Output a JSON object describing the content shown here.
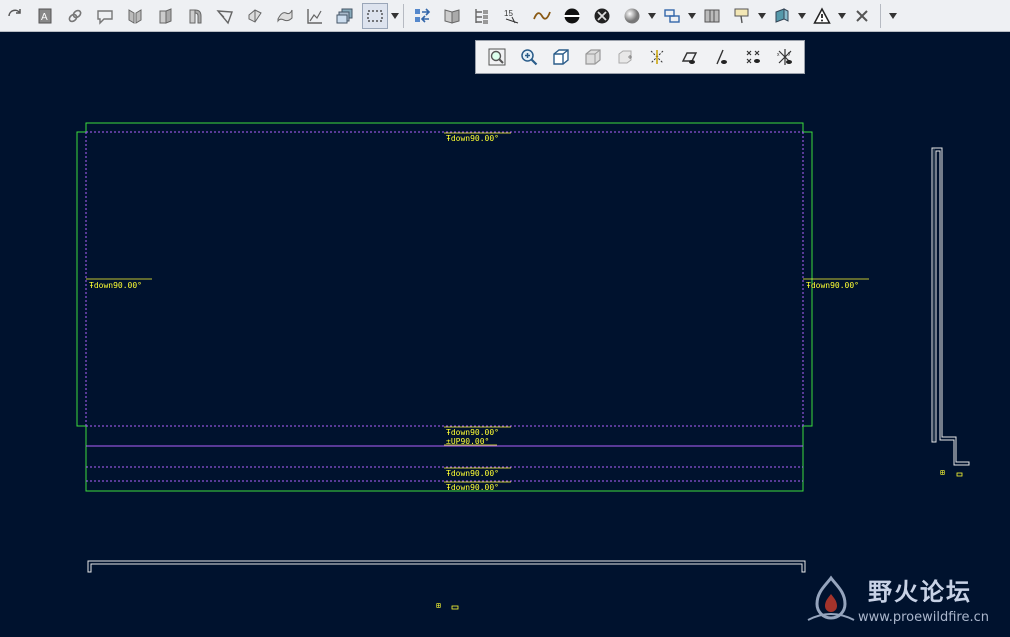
{
  "toolbar": {
    "buttons": [
      "regenerate-icon",
      "annotation-icon",
      "link-icon",
      "callout-icon",
      "flat-pattern-icon",
      "unbend-icon",
      "bend-back-icon",
      "corner-relief-icon",
      "rip-icon",
      "deform-icon",
      "graph-icon",
      "copy-layers-icon",
      "selection-box-icon",
      "refresh-transfer-icon",
      "book-icon",
      "tree-icon",
      "table-icon",
      "curve-icon",
      "hidden-shade-icon",
      "no-hidden-icon",
      "sphere-icon",
      "layout-icon",
      "panels-icon",
      "note-icon",
      "feature-icon",
      "warning-icon",
      "close-window-icon",
      "overflow-icon"
    ]
  },
  "view_toolbar": {
    "buttons": [
      "zoom-fit-icon",
      "zoom-in-icon",
      "shading-icon",
      "no-hidden-box-icon",
      "display-style-icon",
      "datum-planes-icon",
      "datum-axes-icon",
      "datum-points-icon",
      "coord-sys-icon",
      "spin-center-icon"
    ]
  },
  "drawing": {
    "bend_notes": {
      "top": "Ŧdown90.00°",
      "left": "Ŧdown90.00°",
      "right": "Ŧdown90.00°",
      "bottom1": "Ŧdown90.00°",
      "bottom2": "±UP90.00°",
      "bottom3": "Ŧdown90.00°",
      "bottom4": "Ŧdown90.00°"
    },
    "side_view_label": "⊞",
    "bottom_view_label": "⊞",
    "colors": {
      "background": "#00122e",
      "outline": "#3cdc3c",
      "bend_line": "#b060ff",
      "note": "#ffff33",
      "edge": "#e8e8e8"
    }
  },
  "watermark": {
    "title": "野火论坛",
    "url": "www.proewildfire.cn"
  }
}
